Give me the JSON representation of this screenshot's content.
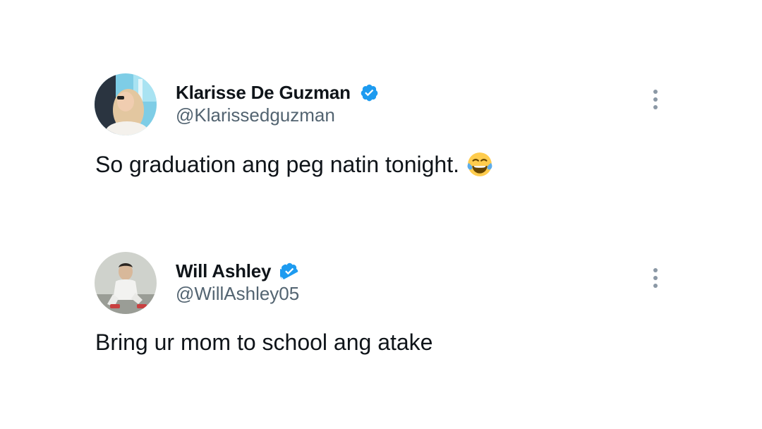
{
  "tweets": [
    {
      "display_name": "Klarisse De Guzman",
      "handle": "@Klarissedguzman",
      "text": "So graduation ang peg natin tonight.",
      "emoji": "face-with-tears-of-joy",
      "verified_color": "#1d9bf0"
    },
    {
      "display_name": "Will Ashley",
      "handle": "@WillAshley05",
      "text": "Bring ur mom to school ang atake",
      "verified_color": "#1d9bf0"
    }
  ],
  "icons": {
    "verified": "verified-badge-icon",
    "more": "more-vertical-icon",
    "emoji": "face-with-tears-of-joy-icon"
  },
  "colors": {
    "text_primary": "#0f1419",
    "text_secondary": "#536471",
    "accent": "#1d9bf0"
  }
}
